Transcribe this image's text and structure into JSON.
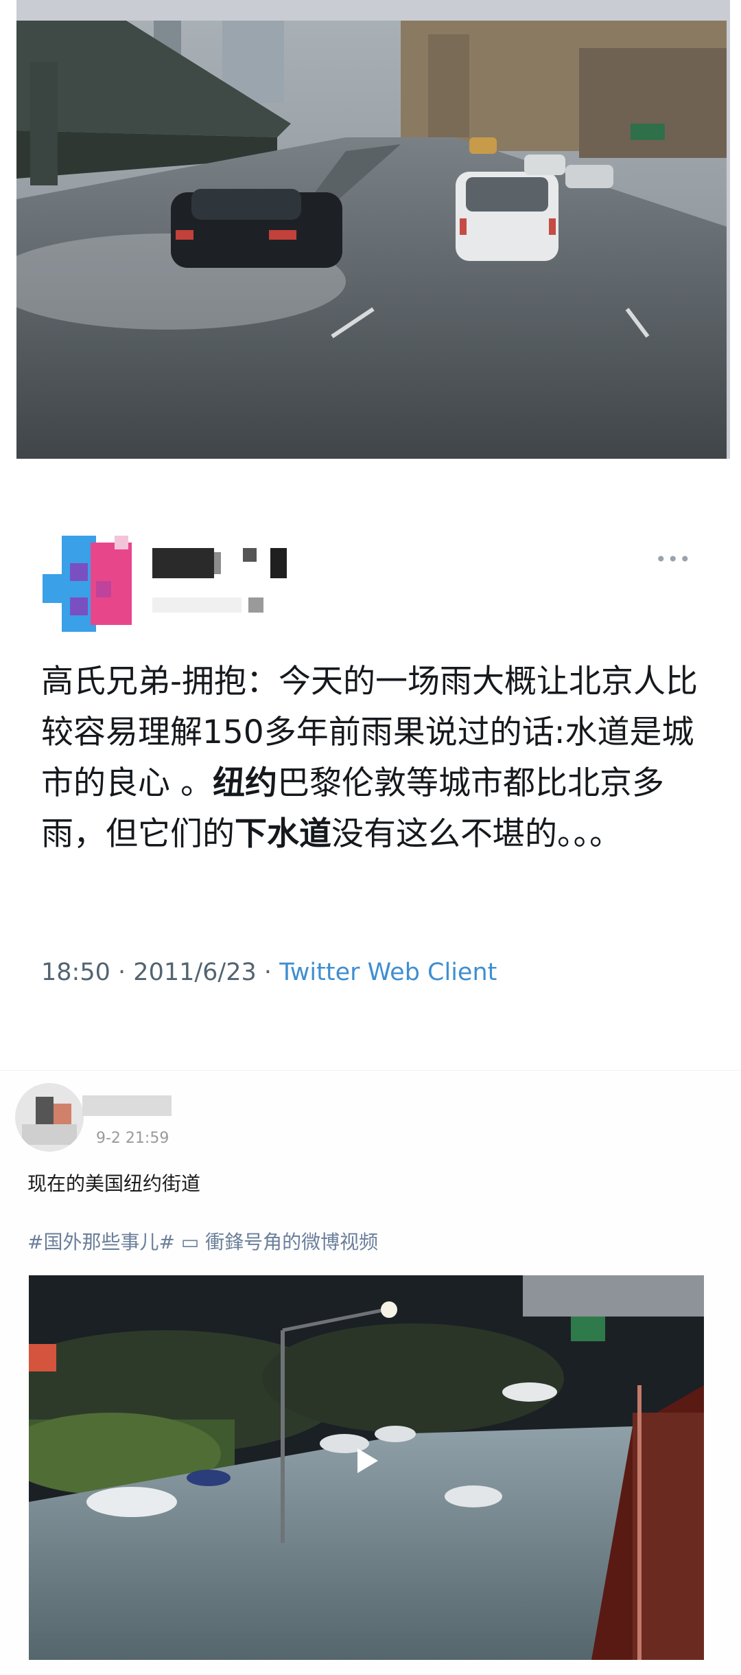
{
  "top_image": {
    "icon": "rainy-highway-photo"
  },
  "tweet": {
    "text_part1": "高氏兄弟-拥抱：今天的一场雨大概让北京人比较容易理解150多年前雨果说过的话:水道是城市的良心 。",
    "bold1": "纽约",
    "text_part2": "巴黎伦敦等城市都比北京多雨，但它们的",
    "bold2": "下水道",
    "text_part3": "没有这么不堪的。。。",
    "time": "18:50",
    "separator": "·",
    "date": "2011/6/23",
    "client": "Twitter Web Client",
    "avatar_colors": [
      "#3aa0e8",
      "#e8468b",
      "#7a4fc2"
    ],
    "more_icon": "more-dots-icon"
  },
  "weibo": {
    "time": "9-2 21:59",
    "text": "现在的美国纽约街道",
    "tags": "#国外那些事儿# ▭ 衝鋒号角的微博视频",
    "video_icon": "play-icon"
  }
}
